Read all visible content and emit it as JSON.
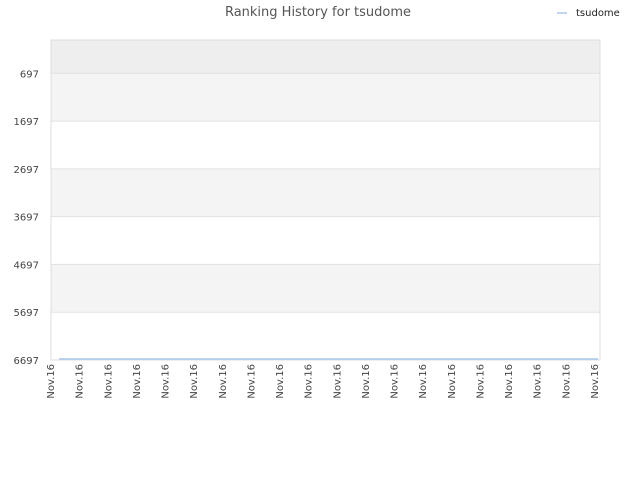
{
  "chart_data": {
    "type": "line",
    "title": "Ranking History for tsudome",
    "xlabel": "",
    "ylabel": "",
    "inverted_y": true,
    "ylim": [
      6697,
      0
    ],
    "y_ticks": [
      697,
      1697,
      2697,
      3697,
      4697,
      5697,
      6697
    ],
    "x_tick_labels": [
      "Nov.16",
      "Nov.16",
      "Nov.16",
      "Nov.16",
      "Nov.16",
      "Nov.16",
      "Nov.16",
      "Nov.16",
      "Nov.16",
      "Nov.16",
      "Nov.16",
      "Nov.16",
      "Nov.16",
      "Nov.16",
      "Nov.16",
      "Nov.16",
      "Nov.16",
      "Nov.16",
      "Nov.16",
      "Nov.16"
    ],
    "series": [
      {
        "name": "tsudome",
        "color": "#a8c8ec",
        "x": [
          "Nov.16",
          "Nov.16"
        ],
        "values": [
          6697,
          6697
        ]
      }
    ],
    "legend_position": "top-right",
    "grid": true,
    "band_colors": [
      "#eeeeee",
      "#f4f4f4",
      "#ffffff"
    ]
  }
}
